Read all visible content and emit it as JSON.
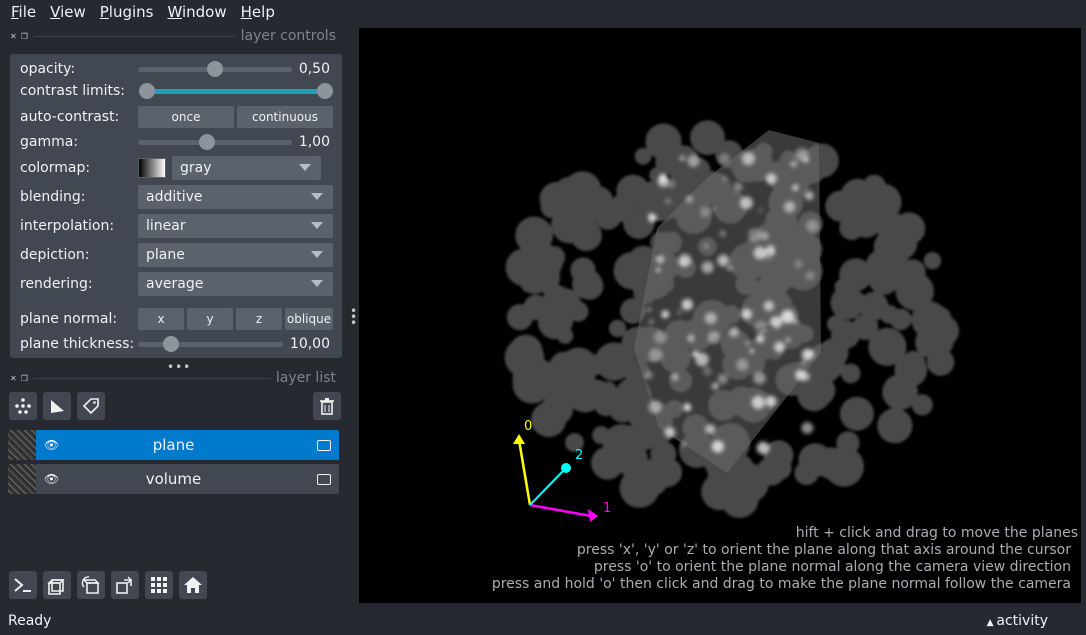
{
  "menu": {
    "items": [
      {
        "key": "F",
        "rest": "ile"
      },
      {
        "key": "V",
        "rest": "iew"
      },
      {
        "key": "P",
        "rest": "lugins"
      },
      {
        "key": "W",
        "rest": "indow"
      },
      {
        "key": "H",
        "rest": "elp"
      }
    ]
  },
  "layer_controls": {
    "title": "layer controls",
    "opacity": {
      "label": "opacity:",
      "value": "0,50",
      "fraction": 0.5
    },
    "contrast_limits": {
      "label": "contrast limits:"
    },
    "auto_contrast": {
      "label": "auto-contrast:",
      "once": "once",
      "continuous": "continuous"
    },
    "gamma": {
      "label": "gamma:",
      "value": "1,00"
    },
    "colormap": {
      "label": "colormap:",
      "value": "gray"
    },
    "blending": {
      "label": "blending:",
      "value": "additive"
    },
    "interpolation": {
      "label": "interpolation:",
      "value": "linear"
    },
    "depiction": {
      "label": "depiction:",
      "value": "plane"
    },
    "rendering": {
      "label": "rendering:",
      "value": "average"
    },
    "plane_normal": {
      "label": "plane normal:",
      "x": "x",
      "y": "y",
      "z": "z",
      "oblique": "oblique"
    },
    "plane_thickness": {
      "label": "plane thickness:",
      "value": "10,00"
    }
  },
  "layer_list": {
    "title": "layer list",
    "layers": [
      {
        "name": "plane",
        "selected": true
      },
      {
        "name": "volume",
        "selected": false
      }
    ]
  },
  "canvas": {
    "axes": {
      "label0": "0",
      "label1": "1",
      "label2": "2"
    },
    "hints": [
      "hift + click and drag to move the planes",
      "press 'x', 'y' or 'z' to orient the plane along that axis around the cursor",
      "press 'o' to orient the plane normal along the camera view direction",
      "press and hold 'o' then click and drag to make the plane normal follow the camera"
    ]
  },
  "status": {
    "text": "Ready",
    "activity": "activity"
  },
  "colors": {
    "background": "#262930",
    "panel": "#414851",
    "control": "#5a626c",
    "selected_layer": "#007acc",
    "accent_track": "#1fa0b8",
    "axis0": "#ffff00",
    "axis1": "#ff00ff",
    "axis2": "#00ffff"
  }
}
